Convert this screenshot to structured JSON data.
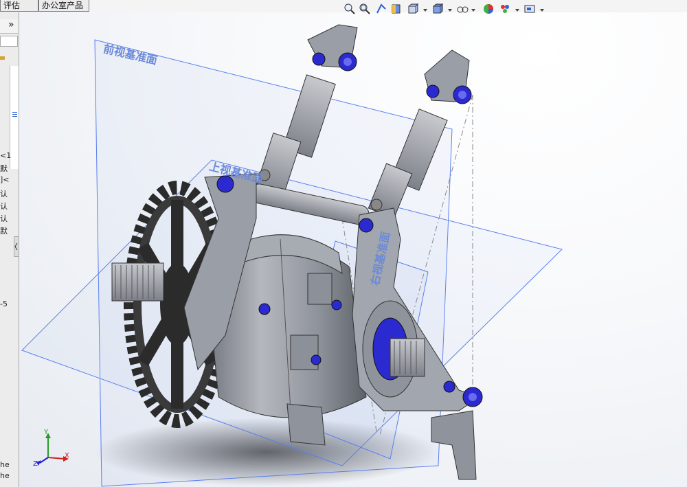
{
  "tabs": [
    {
      "label": "评估"
    },
    {
      "label": "办公室产品"
    }
  ],
  "left_panel": {
    "expand_glyph": "»",
    "fragments": [
      "<1",
      "默",
      "]<",
      "认",
      "认",
      "认",
      "默",
      "-5",
      "he",
      "he"
    ]
  },
  "hud_toolbar": {
    "icons": [
      "zoom-to-fit-icon",
      "zoom-to-area-icon",
      "previous-view-icon",
      "section-view-icon",
      "view-orientation-icon",
      "display-style-icon",
      "hide-show-items-icon",
      "edit-appearance-icon",
      "apply-scene-icon",
      "view-settings-icon"
    ]
  },
  "viewport": {
    "planes": {
      "front": "前视基准面",
      "top": "上视基准面",
      "right": "右视基准面"
    },
    "triad": {
      "x": "X",
      "y": "Y",
      "z": "Z"
    }
  },
  "colors": {
    "plane_edge": "#5a7ef0",
    "metal": "#8f939b",
    "bolt": "#2323c8",
    "sprocket": "#2b2b2b"
  }
}
